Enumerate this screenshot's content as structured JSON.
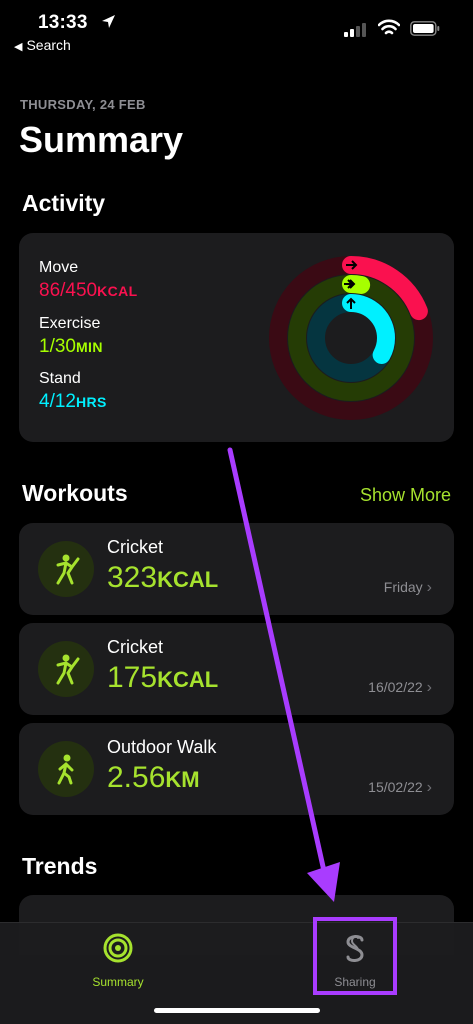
{
  "status_bar": {
    "time": "13:33",
    "back_label": "Search"
  },
  "header": {
    "date": "THURSDAY, 24 FEB",
    "title": "Summary"
  },
  "activity": {
    "heading": "Activity",
    "move": {
      "label": "Move",
      "value": "86/450",
      "unit": "KCAL",
      "progress": 0.19,
      "color": "#fa114f"
    },
    "exercise": {
      "label": "Exercise",
      "value": "1/30",
      "unit": "MIN",
      "progress": 0.03,
      "color": "#a6ff00"
    },
    "stand": {
      "label": "Stand",
      "value": "4/12",
      "unit": "HRS",
      "progress": 0.33,
      "color": "#00f0ff"
    }
  },
  "workouts": {
    "heading": "Workouts",
    "show_more": "Show More",
    "items": [
      {
        "name": "Cricket",
        "value": "323",
        "unit": "KCAL",
        "date": "Friday",
        "icon": "cricket-icon"
      },
      {
        "name": "Cricket",
        "value": "175",
        "unit": "KCAL",
        "date": "16/02/22",
        "icon": "cricket-icon"
      },
      {
        "name": "Outdoor Walk",
        "value": "2.56",
        "unit": "KM",
        "date": "15/02/22",
        "icon": "walk-icon"
      }
    ]
  },
  "trends": {
    "heading": "Trends"
  },
  "tabbar": {
    "summary_label": "Summary",
    "sharing_label": "Sharing",
    "active_color": "#a6e22e",
    "highlight_color": "#a93cff"
  }
}
